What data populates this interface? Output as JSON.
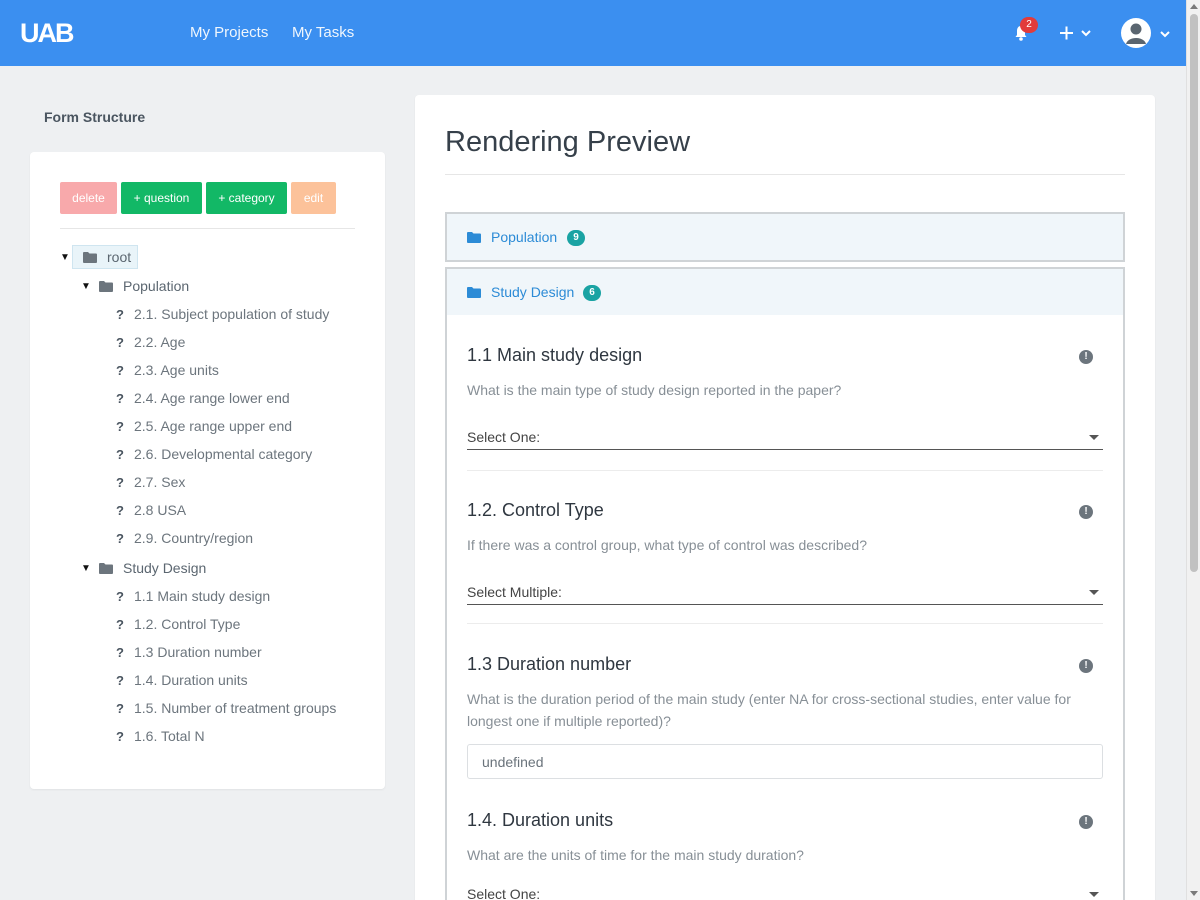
{
  "navbar": {
    "logo_text": "UAB",
    "links": [
      "My Projects",
      "My Tasks"
    ],
    "notification_count": "2",
    "brand_color": "#3b8ff0"
  },
  "sidebar": {
    "title": "Form Structure",
    "buttons": {
      "delete": "delete",
      "add_question": "+ question",
      "add_category": "+ category",
      "edit": "edit"
    },
    "root_label": "root",
    "categories": [
      {
        "label": "Population",
        "items": [
          "2.1. Subject population of study",
          "2.2. Age",
          "2.3. Age units",
          "2.4. Age range lower end",
          "2.5. Age range upper end",
          "2.6. Developmental category",
          "2.7. Sex",
          "2.8 USA",
          "2.9. Country/region"
        ]
      },
      {
        "label": "Study Design",
        "items": [
          "1.1 Main study design",
          "1.2. Control Type",
          "1.3 Duration number",
          "1.4. Duration units",
          "1.5. Number of treatment groups",
          "1.6. Total N"
        ]
      }
    ],
    "question_mark": "?",
    "toggle_glyph": "▼"
  },
  "preview": {
    "title": "Rendering Preview",
    "categories": [
      {
        "label": "Population",
        "count": "9"
      },
      {
        "label": "Study Design",
        "count": "6"
      }
    ],
    "questions": [
      {
        "title": "1.1 Main study design",
        "description": "What is the main type of study design reported in the paper?",
        "select_value": "Select One:"
      },
      {
        "title": "1.2. Control Type",
        "description": "If there was a control group, what type of control was described?",
        "select_value": "Select Multiple:"
      },
      {
        "title": "1.3 Duration number",
        "description": "What is the duration period of the main study (enter NA for cross-sectional studies, enter value for longest one if multiple reported)?",
        "input_value": "undefined"
      },
      {
        "title": "1.4. Duration units",
        "description": "What are the units of time for the main study duration?",
        "select_value": "Select One:"
      }
    ],
    "info_glyph": "!"
  }
}
